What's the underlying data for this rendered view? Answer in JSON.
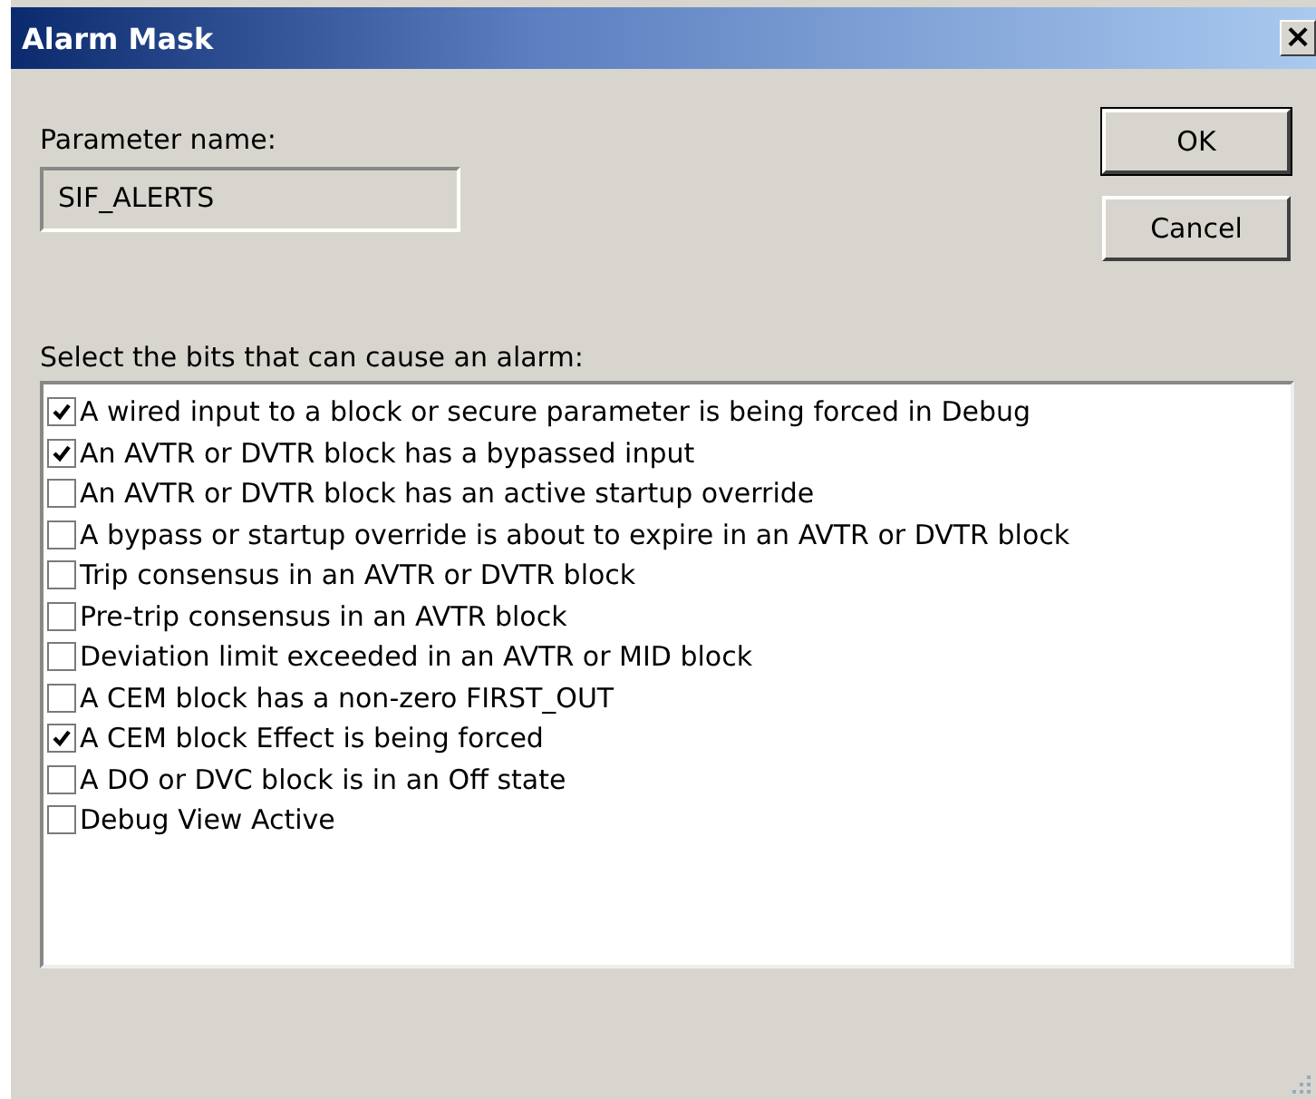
{
  "window": {
    "title": "Alarm Mask",
    "close": "×"
  },
  "parameter": {
    "label": "Parameter name:",
    "value": "SIF_ALERTS"
  },
  "buttons": [
    "OK",
    "Cancel"
  ],
  "bits_label": "Select the bits that can cause an alarm:",
  "bits": [
    {
      "label": "A wired input to a block or secure parameter is being forced in Debug",
      "checked": true
    },
    {
      "label": "An AVTR or DVTR block has a bypassed input",
      "checked": true
    },
    {
      "label": "An AVTR or DVTR block has an active startup override",
      "checked": false
    },
    {
      "label": "A bypass or startup override is about to expire in an AVTR or DVTR block",
      "checked": false
    },
    {
      "label": "Trip consensus in an AVTR or DVTR block",
      "checked": false
    },
    {
      "label": "Pre-trip consensus in an AVTR block",
      "checked": false
    },
    {
      "label": "Deviation limit exceeded in an AVTR or MID block",
      "checked": false
    },
    {
      "label": "A CEM block has a non-zero FIRST_OUT",
      "checked": false
    },
    {
      "label": "A CEM block Effect is being forced",
      "checked": true
    },
    {
      "label": "A DO or DVC block is in an Off state",
      "checked": false
    },
    {
      "label": "Debug View Active",
      "checked": false
    }
  ]
}
